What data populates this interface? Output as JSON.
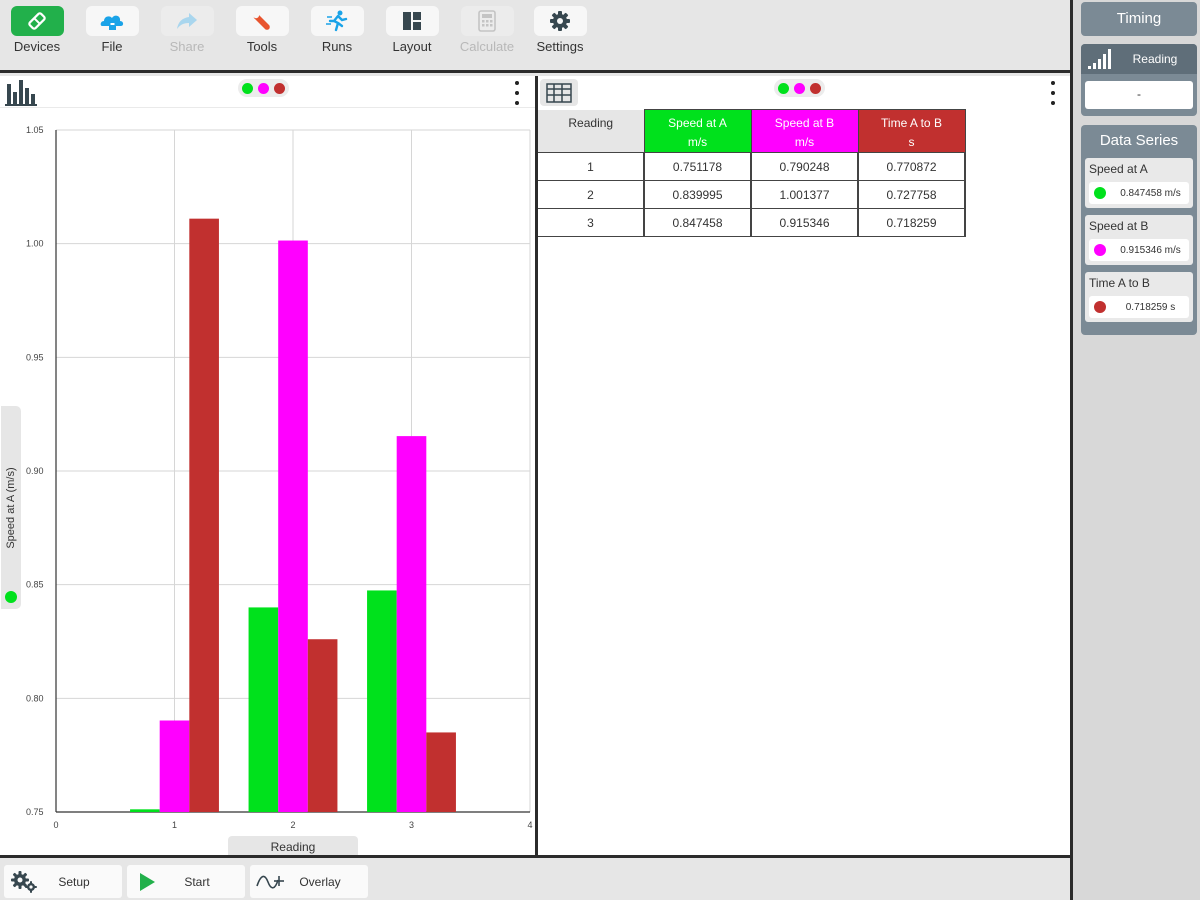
{
  "toolbar": {
    "buttons": [
      {
        "label": "Devices",
        "icon": "devices-icon",
        "active": true
      },
      {
        "label": "File",
        "icon": "file-icon"
      },
      {
        "label": "Share",
        "icon": "share-icon",
        "disabled": true
      },
      {
        "label": "Tools",
        "icon": "tools-icon"
      },
      {
        "label": "Runs",
        "icon": "runs-icon"
      },
      {
        "label": "Layout",
        "icon": "layout-icon"
      },
      {
        "label": "Calculate",
        "icon": "calculate-icon",
        "disabled": true
      },
      {
        "label": "Settings",
        "icon": "settings-icon"
      }
    ]
  },
  "colors": {
    "speed_a": "#00e11c",
    "speed_b": "#ff00ff",
    "time_ab": "#c1302f",
    "accent_green": "#22b04b",
    "icon_blue": "#1aa3e8",
    "sidebar_slate": "#7b8a95"
  },
  "chart_data": {
    "type": "bar",
    "ylabel": "Speed at A (m/s)",
    "xlabel": "Reading",
    "xlim": [
      0,
      4
    ],
    "ylim": [
      0.75,
      1.05
    ],
    "x_ticks": [
      "0",
      "1",
      "2",
      "3",
      "4"
    ],
    "y_ticks": [
      "0.75",
      "0.80",
      "0.85",
      "0.90",
      "0.95",
      "1.00",
      "1.05"
    ],
    "grid": true,
    "categories": [
      1,
      2,
      3
    ],
    "series": [
      {
        "name": "Speed at A",
        "values": [
          0.751178,
          0.839995,
          0.847458
        ]
      },
      {
        "name": "Speed at B",
        "values": [
          0.790248,
          1.001377,
          0.915346
        ]
      },
      {
        "name": "Time A to B",
        "values": [
          0.770872,
          0.727758,
          0.718259
        ],
        "display_values": [
          1.011,
          0.826,
          0.785
        ]
      }
    ]
  },
  "table": {
    "headers": [
      {
        "line1": "Reading",
        "line2": ""
      },
      {
        "line1": "Speed at A",
        "line2": "m/s"
      },
      {
        "line1": "Speed at B",
        "line2": "m/s"
      },
      {
        "line1": "Time A to B",
        "line2": "s"
      }
    ],
    "rows": [
      [
        "1",
        "0.751178",
        "0.790248",
        "0.770872"
      ],
      [
        "2",
        "0.839995",
        "1.001377",
        "0.727758"
      ],
      [
        "3",
        "0.847458",
        "0.915346",
        "0.718259"
      ]
    ]
  },
  "bottom": {
    "setup": "Setup",
    "start": "Start",
    "overlay": "Overlay"
  },
  "sidebar": {
    "timing": "Timing",
    "reading_label": "Reading",
    "reading_value": "-",
    "data_series_title": "Data Series",
    "series": [
      {
        "name": "Speed at A",
        "value": "0.847458 m/s"
      },
      {
        "name": "Speed at B",
        "value": "0.915346 m/s"
      },
      {
        "name": "Time A to B",
        "value": "0.718259 s"
      }
    ]
  }
}
